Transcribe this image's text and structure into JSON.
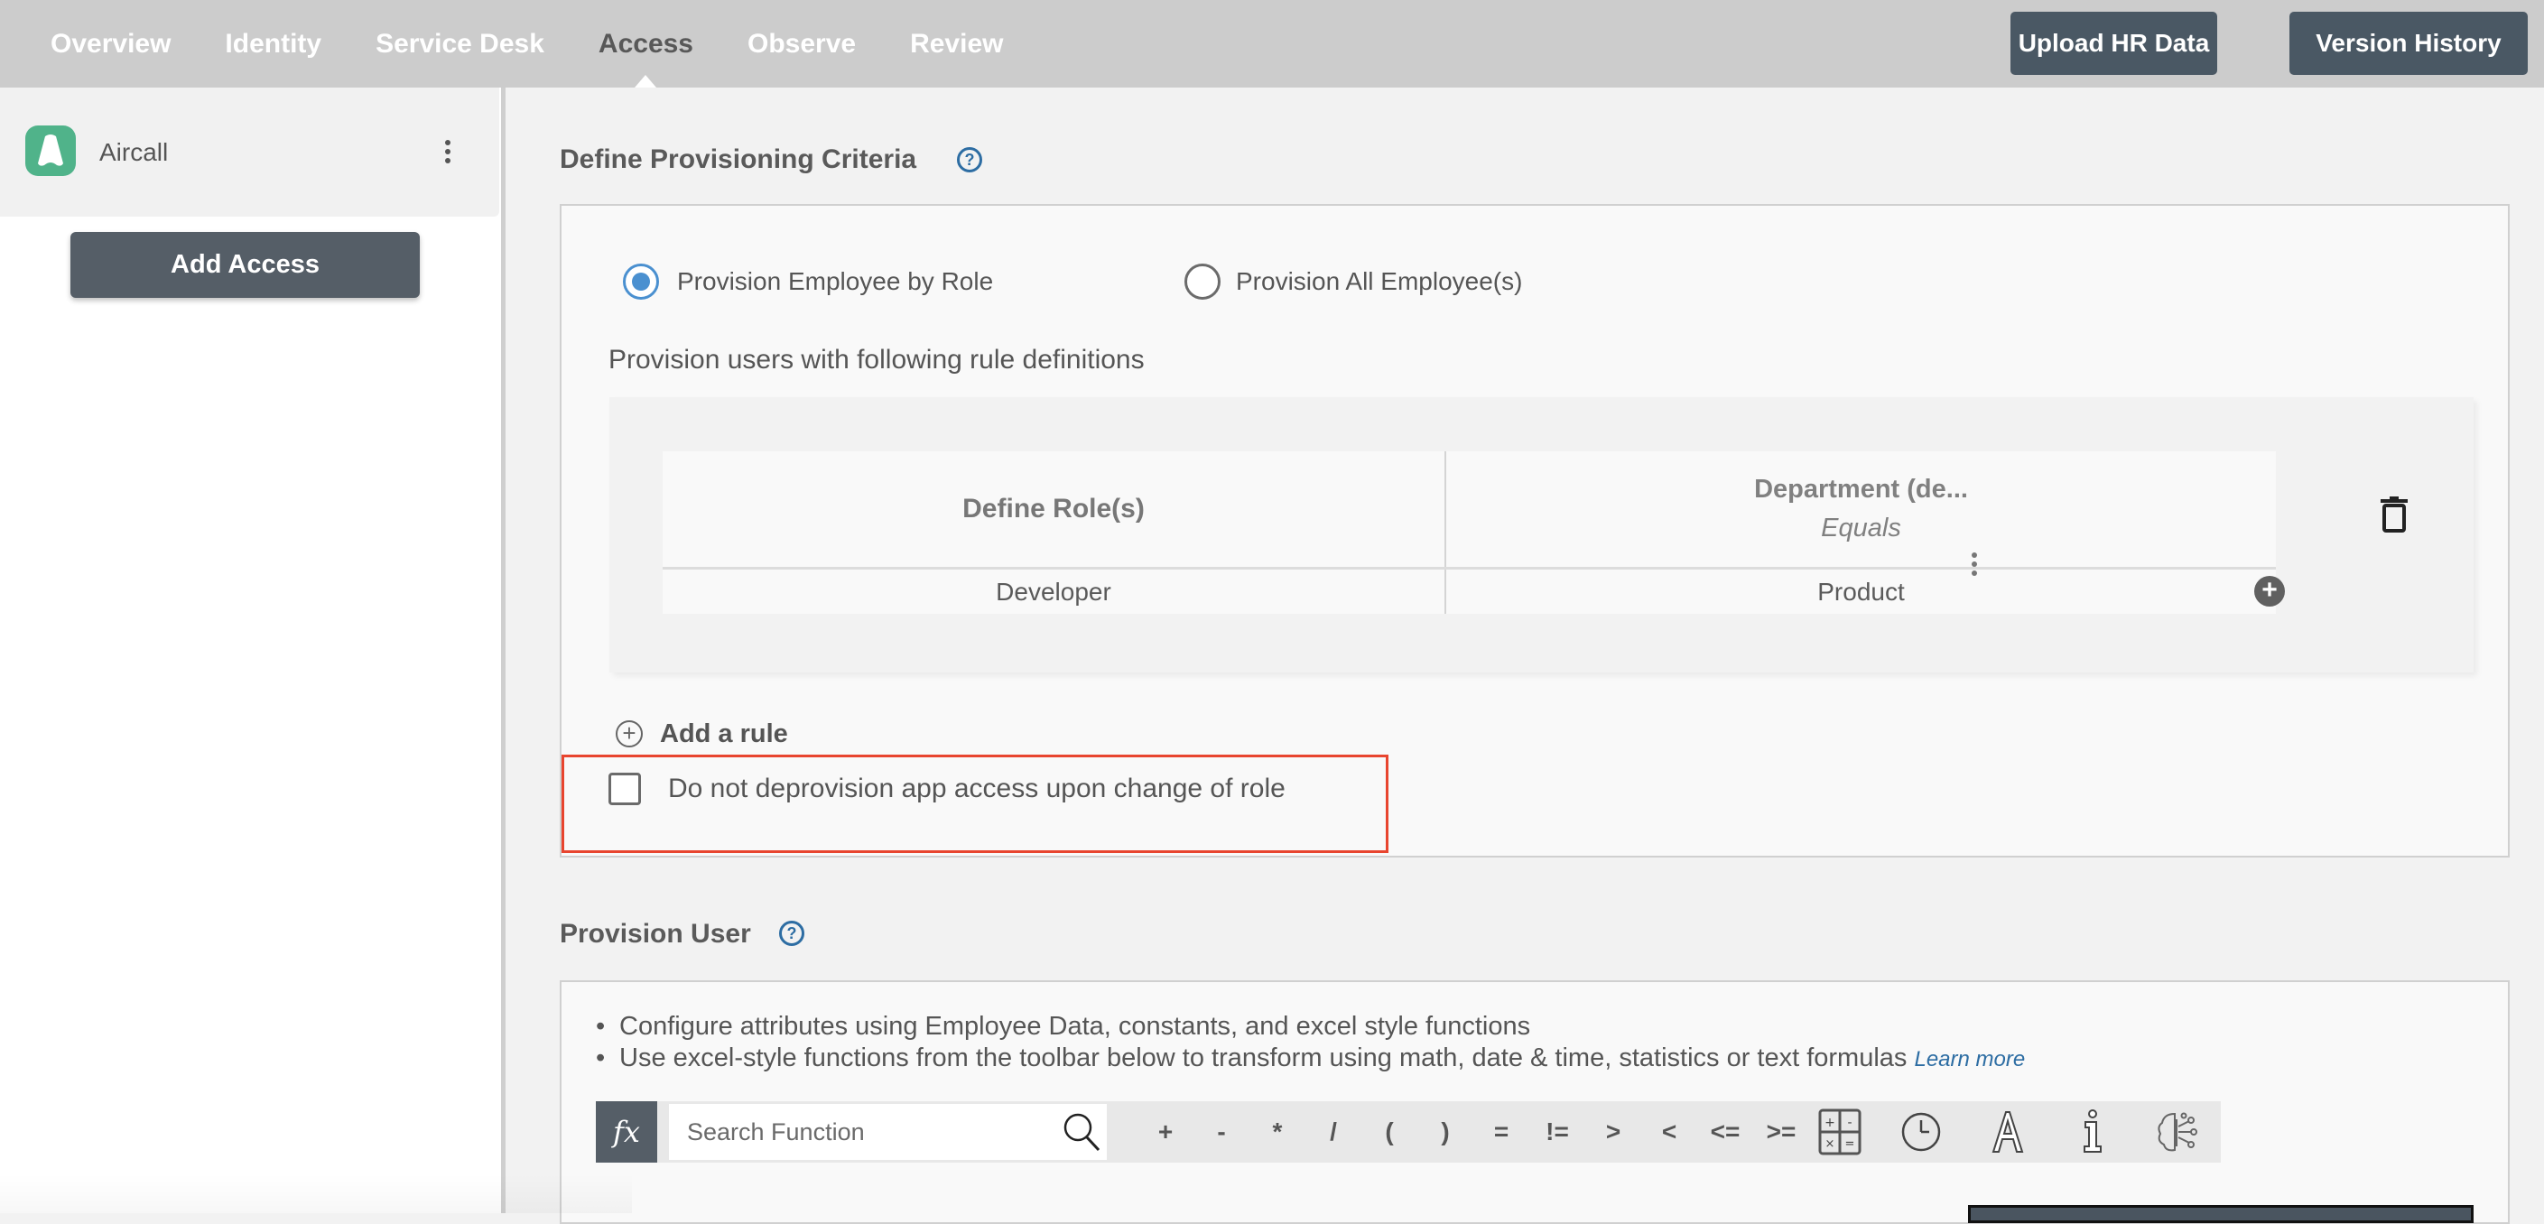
{
  "nav": {
    "tabs": [
      {
        "label": "Overview",
        "active": false
      },
      {
        "label": "Identity",
        "active": false
      },
      {
        "label": "Service Desk",
        "active": false
      },
      {
        "label": "Access",
        "active": true
      },
      {
        "label": "Observe",
        "active": false
      },
      {
        "label": "Review",
        "active": false
      }
    ],
    "upload_label": "Upload HR Data",
    "version_label": "Version History"
  },
  "sidebar": {
    "app_name": "Aircall",
    "add_access_label": "Add Access"
  },
  "criteria": {
    "title": "Define Provisioning Criteria",
    "help_glyph": "?",
    "radio_by_role": {
      "label": "Provision Employee by Role",
      "checked": true
    },
    "radio_all": {
      "label": "Provision All Employee(s)",
      "checked": false
    },
    "subheading": "Provision users with following rule definitions",
    "table": {
      "col_role_header": "Define Role(s)",
      "col_dept_header": "Department (de...",
      "col_dept_operator": "Equals",
      "rows": [
        {
          "role": "Developer",
          "department": "Product"
        }
      ]
    },
    "add_rule_label": "Add a rule",
    "add_rule_glyph": "+",
    "add_column_glyph": "+",
    "deprovision_checkbox": {
      "label": "Do not deprovision app access upon change of role",
      "checked": false
    },
    "highlight_color": "#e8452f"
  },
  "provision_user": {
    "title": "Provision User",
    "help_glyph": "?",
    "bullets": [
      "Configure attributes using Employee Data, constants, and excel style functions",
      "Use excel-style functions from the toolbar below to transform using math, date & time, statistics or text formulas"
    ],
    "learn_more": "Learn more",
    "fx_label": "fx",
    "search_placeholder": "Search Function",
    "operators": [
      "+",
      "-",
      "*",
      "/",
      "(",
      ")",
      "=",
      "!=",
      ">",
      "<",
      "<=",
      ">="
    ],
    "tool_icons": [
      "math-functions-icon",
      "date-time-icon",
      "text-functions-icon",
      "info-icon",
      "ai-brain-icon"
    ]
  },
  "colors": {
    "accent": "#2d6da3",
    "radio_selected": "#4a90d0",
    "button_dark": "#4a5864",
    "aircall_green": "#50b38a"
  }
}
